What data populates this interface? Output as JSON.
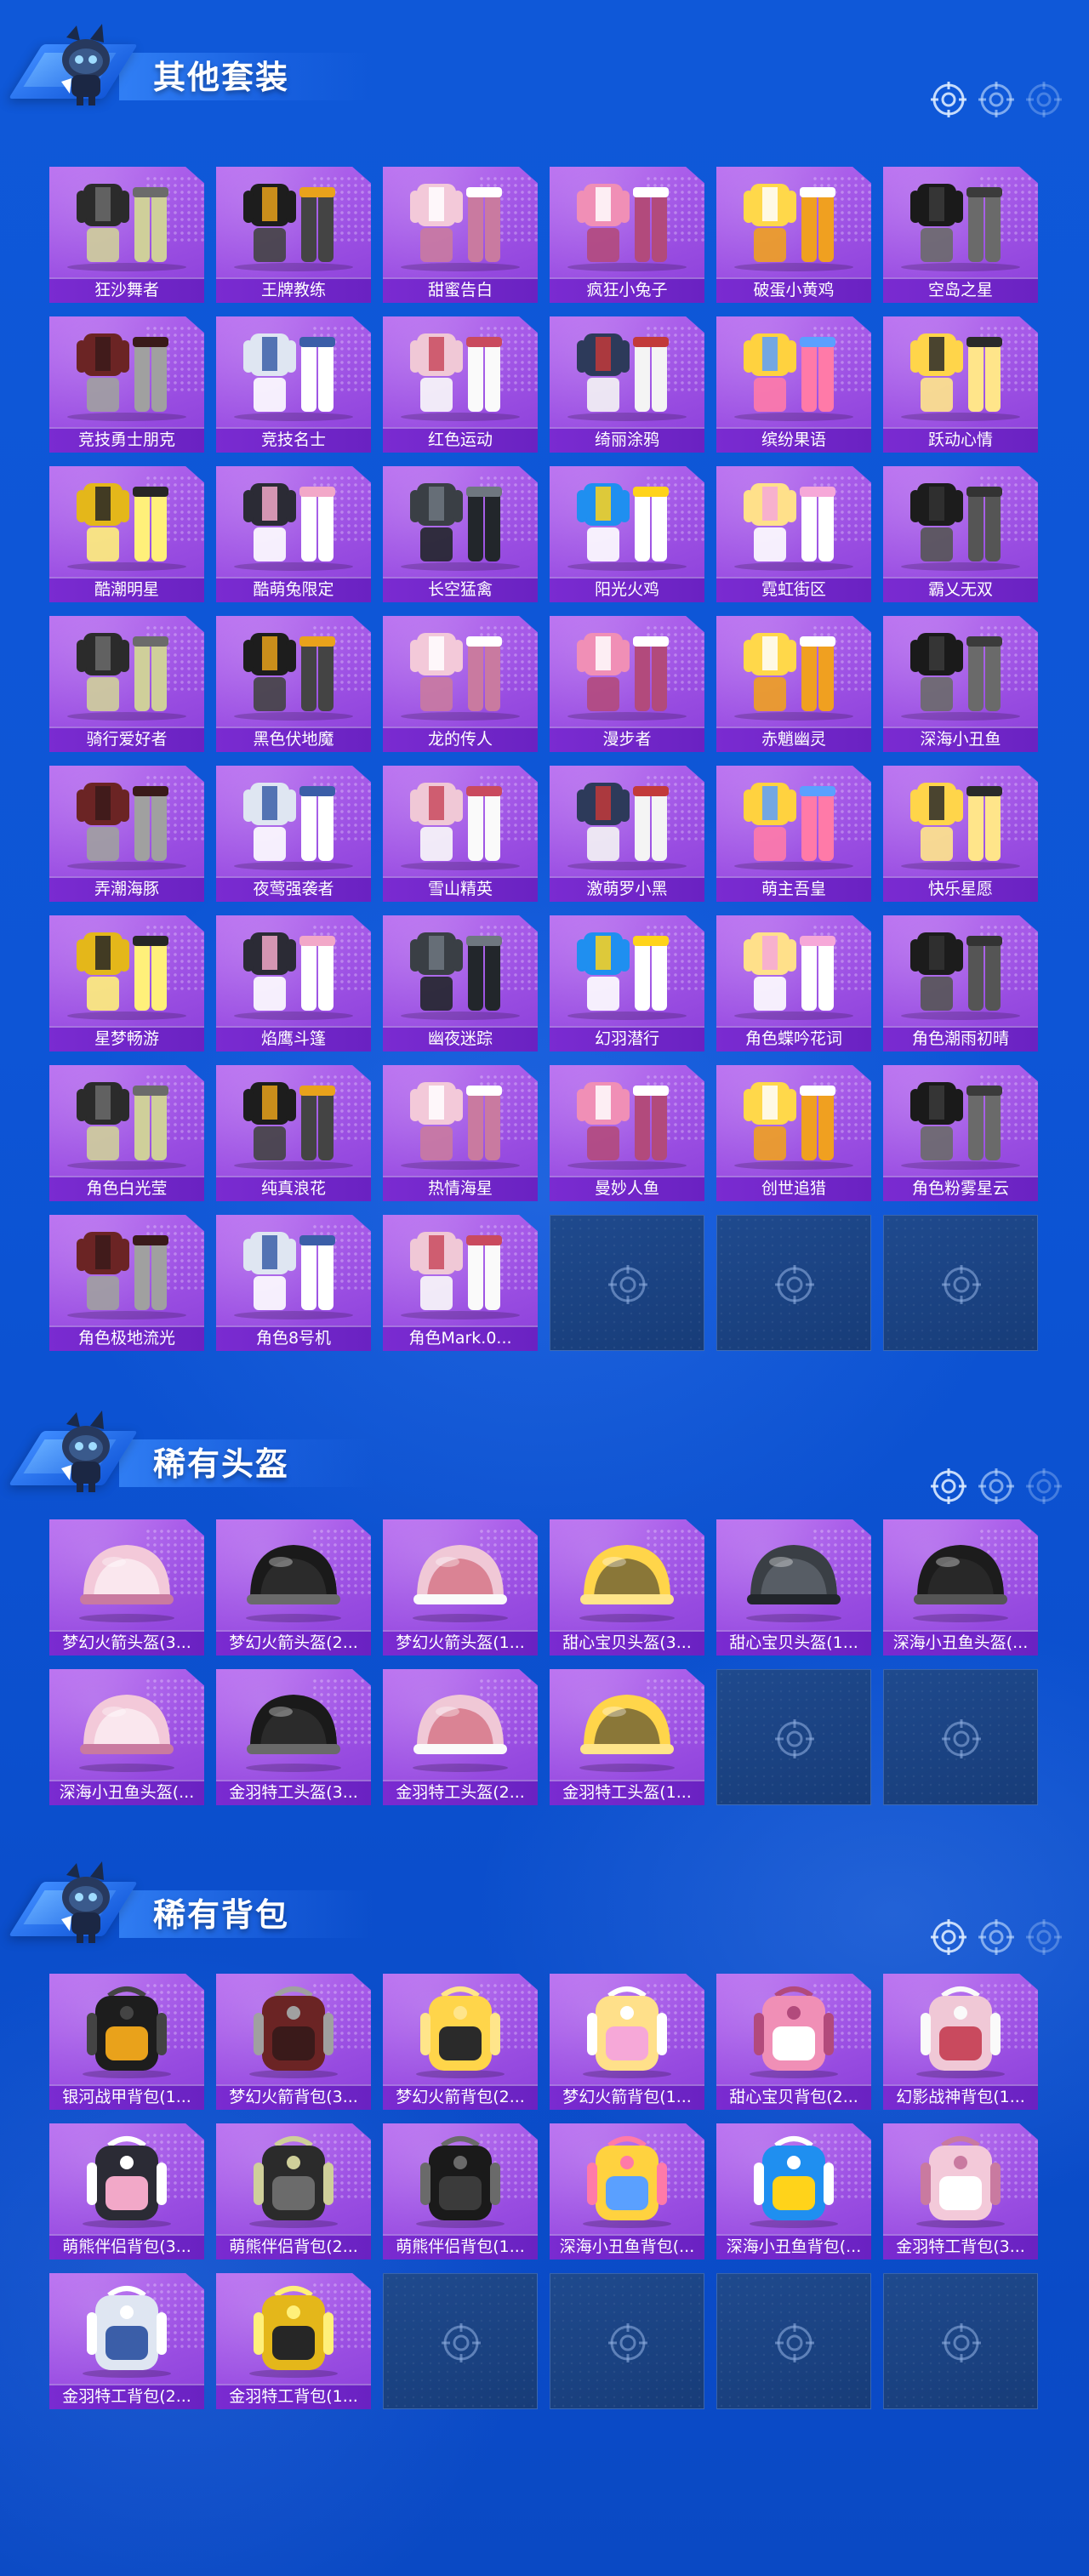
{
  "colors": {
    "background": "#0d55d6",
    "card": "#a155e6",
    "label_bar": "#7a2bd1",
    "empty_slot": "#1f4a8e"
  },
  "sections": [
    {
      "title": "其他套装",
      "icon": "mascot-icon",
      "items": [
        {
          "name": "狂沙舞者",
          "art": "outfit"
        },
        {
          "name": "王牌教练",
          "art": "outfit"
        },
        {
          "name": "甜蜜告白",
          "art": "outfit"
        },
        {
          "name": "疯狂小兔子",
          "art": "outfit"
        },
        {
          "name": "破蛋小黄鸡",
          "art": "outfit"
        },
        {
          "name": "空岛之星",
          "art": "outfit"
        },
        {
          "name": "竞技勇士朋克",
          "art": "outfit"
        },
        {
          "name": "竞技名士",
          "art": "outfit"
        },
        {
          "name": "红色运动",
          "art": "outfit"
        },
        {
          "name": "绮丽涂鸦",
          "art": "outfit"
        },
        {
          "name": "缤纷果语",
          "art": "outfit"
        },
        {
          "name": "跃动心情",
          "art": "outfit"
        },
        {
          "name": "酷潮明星",
          "art": "outfit"
        },
        {
          "name": "酷萌兔限定",
          "art": "outfit"
        },
        {
          "name": "长空猛禽",
          "art": "outfit"
        },
        {
          "name": "阳光火鸡",
          "art": "outfit"
        },
        {
          "name": "霓虹街区",
          "art": "outfit"
        },
        {
          "name": "霸乂无双",
          "art": "outfit"
        },
        {
          "name": "骑行爱好者",
          "art": "outfit"
        },
        {
          "name": "黑色伏地魔",
          "art": "outfit"
        },
        {
          "name": "龙的传人",
          "art": "outfit"
        },
        {
          "name": "漫步者",
          "art": "outfit"
        },
        {
          "name": "赤魈幽灵",
          "art": "outfit"
        },
        {
          "name": "深海小丑鱼",
          "art": "outfit"
        },
        {
          "name": "弄潮海豚",
          "art": "outfit"
        },
        {
          "name": "夜莺强袭者",
          "art": "outfit"
        },
        {
          "name": "雪山精英",
          "art": "outfit"
        },
        {
          "name": "激萌罗小黑",
          "art": "outfit"
        },
        {
          "name": "萌主吾皇",
          "art": "outfit"
        },
        {
          "name": "快乐星愿",
          "art": "outfit"
        },
        {
          "name": "星梦畅游",
          "art": "outfit"
        },
        {
          "name": "焰鹰斗篷",
          "art": "outfit"
        },
        {
          "name": "幽夜迷踪",
          "art": "outfit"
        },
        {
          "name": "幻羽潜行",
          "art": "outfit"
        },
        {
          "name": "角色蝶吟花词",
          "art": "outfit"
        },
        {
          "name": "角色潮雨初晴",
          "art": "outfit"
        },
        {
          "name": "角色白光莹",
          "art": "outfit"
        },
        {
          "name": "纯真浪花",
          "art": "outfit"
        },
        {
          "name": "热情海星",
          "art": "outfit"
        },
        {
          "name": "曼妙人鱼",
          "art": "outfit"
        },
        {
          "name": "创世追猎",
          "art": "outfit"
        },
        {
          "name": "角色粉雾星云",
          "art": "outfit"
        },
        {
          "name": "角色极地流光",
          "art": "outfit"
        },
        {
          "name": "角色8号机",
          "art": "outfit"
        },
        {
          "name": "角色Mark.0...",
          "art": "outfit"
        }
      ],
      "empty_slots": 3
    },
    {
      "title": "稀有头盔",
      "icon": "mascot-icon",
      "items": [
        {
          "name": "梦幻火箭头盔(3...",
          "art": "helmet"
        },
        {
          "name": "梦幻火箭头盔(2...",
          "art": "helmet"
        },
        {
          "name": "梦幻火箭头盔(1...",
          "art": "helmet"
        },
        {
          "name": "甜心宝贝头盔(3...",
          "art": "helmet"
        },
        {
          "name": "甜心宝贝头盔(1...",
          "art": "helmet"
        },
        {
          "name": "深海小丑鱼头盔(...",
          "art": "helmet"
        },
        {
          "name": "深海小丑鱼头盔(...",
          "art": "helmet"
        },
        {
          "name": "金羽特工头盔(3...",
          "art": "helmet"
        },
        {
          "name": "金羽特工头盔(2...",
          "art": "helmet"
        },
        {
          "name": "金羽特工头盔(1...",
          "art": "helmet"
        }
      ],
      "empty_slots": 2
    },
    {
      "title": "稀有背包",
      "icon": "mascot-icon",
      "items": [
        {
          "name": "银河战甲背包(1...",
          "art": "backpack"
        },
        {
          "name": "梦幻火箭背包(3...",
          "art": "backpack"
        },
        {
          "name": "梦幻火箭背包(2...",
          "art": "backpack"
        },
        {
          "name": "梦幻火箭背包(1...",
          "art": "backpack"
        },
        {
          "name": "甜心宝贝背包(2...",
          "art": "backpack"
        },
        {
          "name": "幻影战神背包(1...",
          "art": "backpack"
        },
        {
          "name": "萌熊伴侣背包(3...",
          "art": "backpack"
        },
        {
          "name": "萌熊伴侣背包(2...",
          "art": "backpack"
        },
        {
          "name": "萌熊伴侣背包(1...",
          "art": "backpack"
        },
        {
          "name": "深海小丑鱼背包(...",
          "art": "backpack"
        },
        {
          "name": "深海小丑鱼背包(...",
          "art": "backpack"
        },
        {
          "name": "金羽特工背包(3...",
          "art": "backpack"
        },
        {
          "name": "金羽特工背包(2...",
          "art": "backpack"
        },
        {
          "name": "金羽特工背包(1...",
          "art": "backpack"
        }
      ],
      "empty_slots": 4
    }
  ]
}
